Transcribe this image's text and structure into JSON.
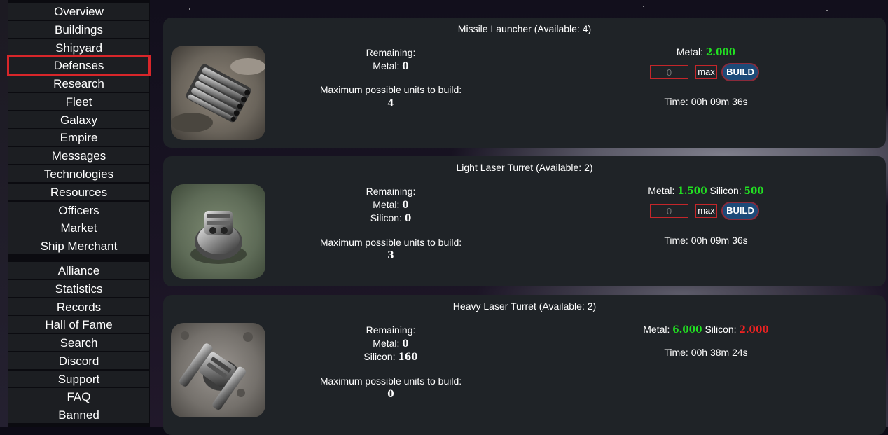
{
  "sidebar": {
    "items": [
      {
        "label": "Overview",
        "name": "sidebar-item-overview"
      },
      {
        "label": "Buildings",
        "name": "sidebar-item-buildings"
      },
      {
        "label": "Shipyard",
        "name": "sidebar-item-shipyard"
      },
      {
        "label": "Defenses",
        "name": "sidebar-item-defenses",
        "active": true
      },
      {
        "label": "Research",
        "name": "sidebar-item-research"
      },
      {
        "label": "Fleet",
        "name": "sidebar-item-fleet"
      },
      {
        "label": "Galaxy",
        "name": "sidebar-item-galaxy"
      },
      {
        "label": "Empire",
        "name": "sidebar-item-empire"
      },
      {
        "label": "Messages",
        "name": "sidebar-item-messages"
      },
      {
        "label": "Technologies",
        "name": "sidebar-item-technologies"
      },
      {
        "label": "Resources",
        "name": "sidebar-item-resources"
      },
      {
        "label": "Officers",
        "name": "sidebar-item-officers"
      },
      {
        "label": "Market",
        "name": "sidebar-item-market"
      },
      {
        "label": "Ship Merchant",
        "name": "sidebar-item-ship-merchant"
      }
    ],
    "items2": [
      {
        "label": "Alliance",
        "name": "sidebar-item-alliance"
      },
      {
        "label": "Statistics",
        "name": "sidebar-item-statistics"
      },
      {
        "label": "Records",
        "name": "sidebar-item-records"
      },
      {
        "label": "Hall of Fame",
        "name": "sidebar-item-hall-of-fame"
      },
      {
        "label": "Search",
        "name": "sidebar-item-search"
      },
      {
        "label": "Discord",
        "name": "sidebar-item-discord"
      },
      {
        "label": "Support",
        "name": "sidebar-item-support"
      },
      {
        "label": "FAQ",
        "name": "sidebar-item-faq"
      },
      {
        "label": "Banned",
        "name": "sidebar-item-banned"
      }
    ]
  },
  "labels": {
    "remaining": "Remaining:",
    "metal": "Metal:",
    "silicon": "Silicon:",
    "max_units": "Maximum possible units to build:",
    "time_prefix": "Time:",
    "qty_placeholder": "0",
    "max_button": "max",
    "build_button": "BUILD"
  },
  "defenses": [
    {
      "title": "Missile Launcher (Available: 4)",
      "remaining_metal": "0",
      "max_units": "4",
      "cost_metal": "2.000",
      "time": "00h 09m 36s"
    },
    {
      "title": "Light Laser Turret (Available: 2)",
      "remaining_metal": "0",
      "remaining_silicon": "0",
      "max_units": "3",
      "cost_metal": "1.500",
      "cost_silicon": "500",
      "time": "00h 09m 36s"
    },
    {
      "title": "Heavy Laser Turret (Available: 2)",
      "remaining_metal": "0",
      "remaining_silicon": "160",
      "max_units": "0",
      "cost_metal": "6.000",
      "cost_silicon": "2.000",
      "time": "00h 38m 24s"
    }
  ],
  "colors": {
    "affordable": "#22e022",
    "unaffordable": "#ee2222",
    "active_outline": "#d8262a"
  }
}
